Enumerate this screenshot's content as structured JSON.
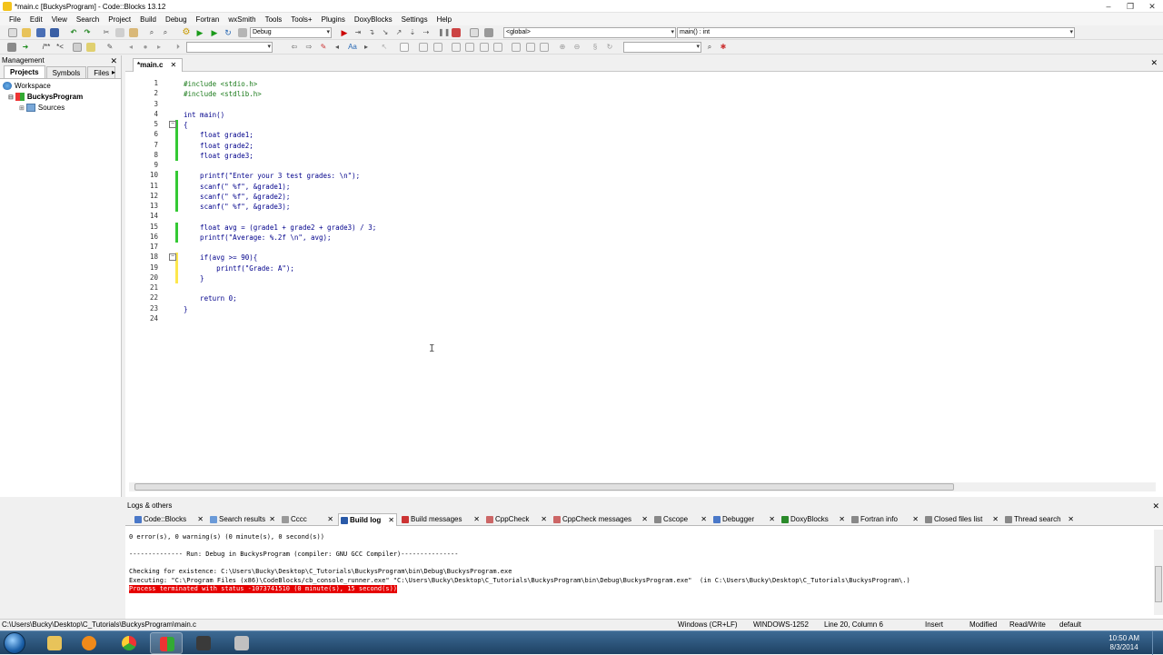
{
  "window": {
    "title": "*main.c [BuckysProgram] - Code::Blocks 13.12",
    "min": "–",
    "max": "❐",
    "close": "✕"
  },
  "menu": [
    "File",
    "Edit",
    "View",
    "Search",
    "Project",
    "Build",
    "Debug",
    "Fortran",
    "wxSmith",
    "Tools",
    "Tools+",
    "Plugins",
    "DoxyBlocks",
    "Settings",
    "Help"
  ],
  "toolbar": {
    "build_target": "Debug",
    "scope": "<global>",
    "function": "main() : int",
    "search_value": "",
    "find_value": ""
  },
  "management": {
    "title": "Management",
    "tabs": [
      "Projects",
      "Symbols",
      "Files"
    ],
    "tree": {
      "workspace": "Workspace",
      "project": "BuckysProgram",
      "folder": "Sources"
    }
  },
  "editor": {
    "tab": "*main.c",
    "line_numbers": [
      "1",
      "2",
      "3",
      "4",
      "5",
      "6",
      "7",
      "8",
      "9",
      "10",
      "11",
      "12",
      "13",
      "14",
      "15",
      "16",
      "17",
      "18",
      "19",
      "20",
      "21",
      "22",
      "23",
      "24"
    ],
    "lines": [
      "#include <stdio.h>",
      "#include <stdlib.h>",
      "",
      "int main()",
      "{",
      "    float grade1;",
      "    float grade2;",
      "    float grade3;",
      "",
      "    printf(\"Enter your 3 test grades: \\n\");",
      "    scanf(\" %f\", &grade1);",
      "    scanf(\" %f\", &grade2);",
      "    scanf(\" %f\", &grade3);",
      "",
      "    float avg = (grade1 + grade2 + grade3) / 3;",
      "    printf(\"Average: %.2f \\n\", avg);",
      "",
      "    if(avg >= 90){",
      "        printf(\"Grade: A\");",
      "    }",
      "",
      "    return 0;",
      "}",
      ""
    ]
  },
  "logs": {
    "title": "Logs & others",
    "tabs": [
      "Code::Blocks",
      "Search results",
      "Cccc",
      "Build log",
      "Build messages",
      "CppCheck",
      "CppCheck messages",
      "Cscope",
      "Debugger",
      "DoxyBlocks",
      "Fortran info",
      "Closed files list",
      "Thread search"
    ],
    "active_tab": "Build log",
    "lines": [
      "0 error(s), 0 warning(s) (0 minute(s), 0 second(s))",
      "",
      "-------------- Run: Debug in BuckysProgram (compiler: GNU GCC Compiler)---------------",
      "",
      "Checking for existence: C:\\Users\\Bucky\\Desktop\\C_Tutorials\\BuckysProgram\\bin\\Debug\\BuckysProgram.exe",
      "Executing: \"C:\\Program Files (x86)\\CodeBlocks/cb_console_runner.exe\" \"C:\\Users\\Bucky\\Desktop\\C_Tutorials\\BuckysProgram\\bin\\Debug\\BuckysProgram.exe\"  (in C:\\Users\\Bucky\\Desktop\\C_Tutorials\\BuckysProgram\\.)"
    ],
    "error_line": "Process terminated with status -1073741510 (0 minute(s), 15 second(s))"
  },
  "status": {
    "path": "C:\\Users\\Bucky\\Desktop\\C_Tutorials\\BuckysProgram\\main.c",
    "eol": "Windows (CR+LF)",
    "encoding": "WINDOWS-1252",
    "position": "Line 20, Column 6",
    "mode": "Insert",
    "modified": "Modified",
    "access": "Read/Write",
    "profile": "default"
  },
  "taskbar": {
    "time": "10:50 AM",
    "date": "8/3/2014"
  }
}
